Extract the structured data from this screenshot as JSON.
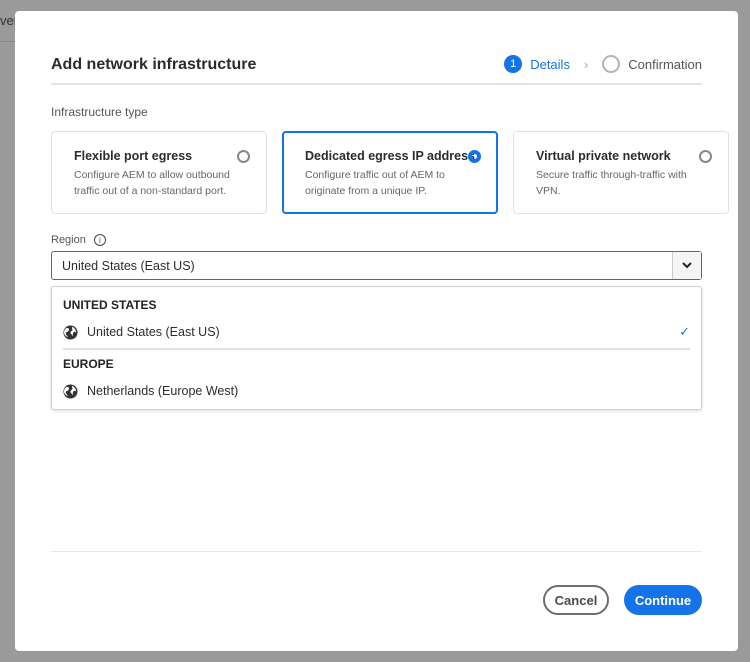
{
  "background": {
    "partial_text": "ver"
  },
  "dialog": {
    "title": "Add network infrastructure",
    "steps": [
      {
        "number": "1",
        "label": "Details",
        "active": true
      },
      {
        "label": "Confirmation",
        "active": false
      }
    ],
    "infrastructure_label": "Infrastructure type",
    "options": [
      {
        "title": "Flexible port egress",
        "description": "Configure AEM to allow outbound traffic out of a non-standard port.",
        "selected": false
      },
      {
        "title": "Dedicated egress IP address",
        "description": "Configure traffic out of AEM to originate from a unique IP.",
        "selected": true
      },
      {
        "title": "Virtual private network",
        "description": "Secure traffic through-traffic with VPN.",
        "selected": false
      }
    ],
    "region": {
      "label": "Region",
      "info_icon": "info-icon",
      "value": "United States (East US)",
      "menu": [
        {
          "section": "UNITED STATES",
          "items": [
            {
              "label": "United States (East US)",
              "icon": "globe-icon",
              "checked": true
            }
          ]
        },
        {
          "section": "EUROPE",
          "items": [
            {
              "label": "Netherlands (Europe West)",
              "icon": "globe-icon",
              "checked": false
            }
          ]
        }
      ]
    },
    "buttons": {
      "cancel": "Cancel",
      "continue": "Continue"
    },
    "accent": "#1473e6"
  }
}
